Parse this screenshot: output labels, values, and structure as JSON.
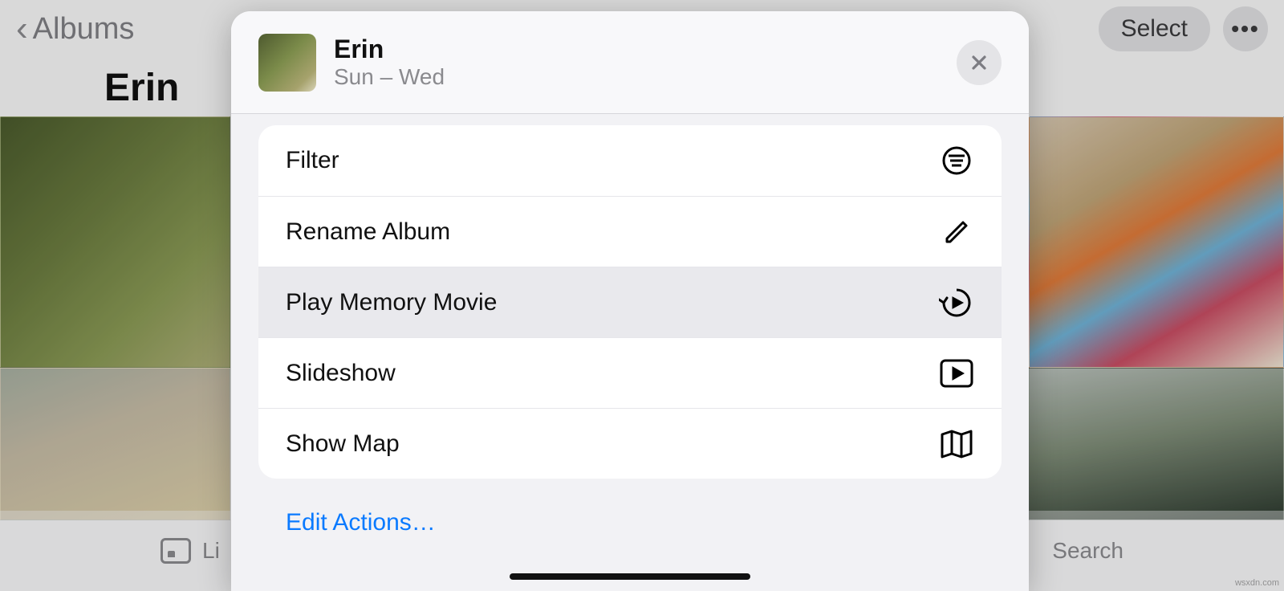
{
  "nav": {
    "back_label": "Albums",
    "select_label": "Select",
    "more_label": "•••"
  },
  "album": {
    "title": "Erin"
  },
  "tabs": {
    "left_label": "Li",
    "right_label": "Search"
  },
  "sheet": {
    "title": "Erin",
    "subtitle": "Sun – Wed",
    "actions": [
      {
        "label": "Filter",
        "icon": "filter-icon",
        "highlighted": false
      },
      {
        "label": "Rename Album",
        "icon": "pencil-icon",
        "highlighted": false
      },
      {
        "label": "Play Memory Movie",
        "icon": "memory-play-icon",
        "highlighted": true
      },
      {
        "label": "Slideshow",
        "icon": "play-rect-icon",
        "highlighted": false
      },
      {
        "label": "Show Map",
        "icon": "map-icon",
        "highlighted": false
      }
    ],
    "edit_actions_label": "Edit Actions…"
  },
  "watermark": "wsxdn.com"
}
